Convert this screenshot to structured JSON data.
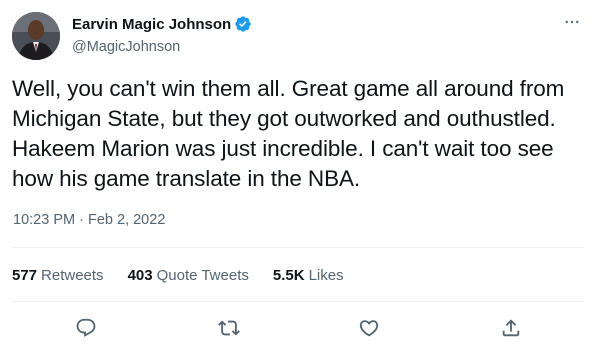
{
  "author": {
    "display_name": "Earvin Magic Johnson",
    "handle": "@MagicJohnson",
    "verified": true
  },
  "tweet": {
    "lines": [
      "Well, you can't win them all. Great game all around from",
      "Michigan State, but they got outworked and outhustled.",
      "Hakeem Marion was just incredible. I can't wait too see",
      "how his game translate in the NBA."
    ],
    "time": "10:23 PM",
    "separator": "·",
    "date": "Feb 2, 2022"
  },
  "stats": {
    "retweets_count": "577",
    "retweets_label": "Retweets",
    "quote_count": "403",
    "quote_label": "Quote Tweets",
    "likes_count": "5.5K",
    "likes_label": "Likes"
  },
  "icons": {
    "more": "more-horizontal-icon",
    "verified": "verified-badge-icon",
    "reply": "reply-icon",
    "retweet": "retweet-icon",
    "like": "heart-icon",
    "share": "share-icon"
  },
  "colors": {
    "text_primary": "#0f1419",
    "text_secondary": "#536471",
    "verified_blue": "#1d9bf0",
    "divider": "#eff3f4"
  }
}
